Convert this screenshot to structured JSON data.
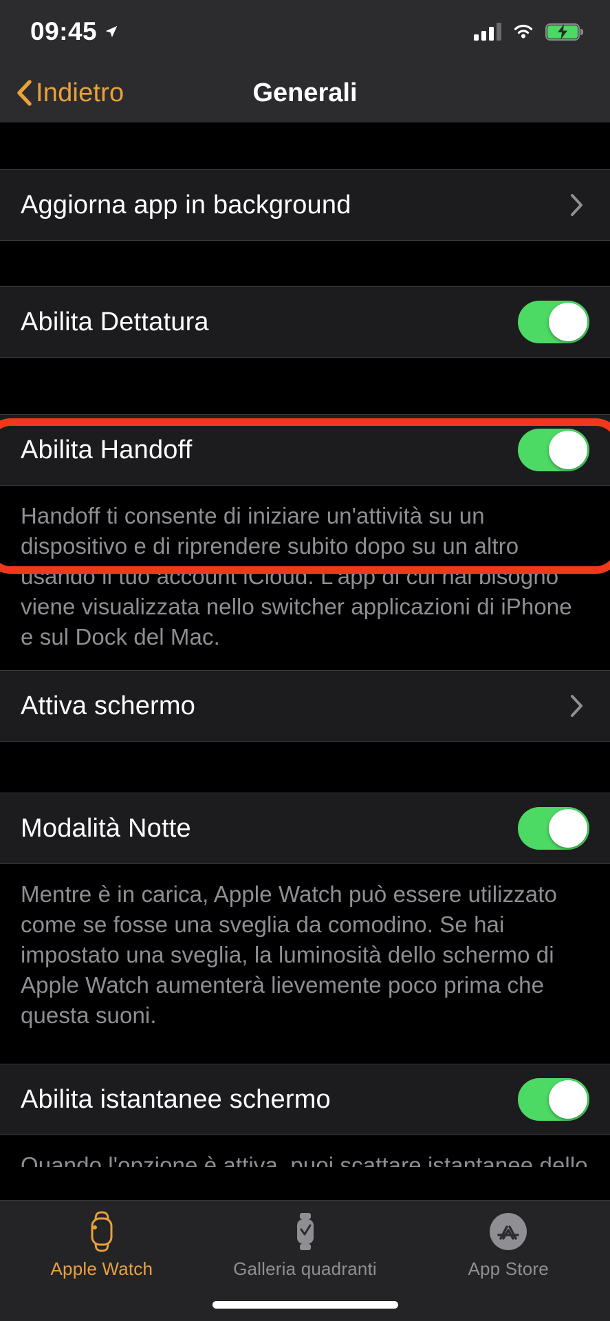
{
  "status_bar": {
    "time": "09:45",
    "location_icon": "location-arrow-icon",
    "signal_icon": "cellular-signal-icon",
    "wifi_icon": "wifi-icon",
    "battery_icon": "battery-charging-icon",
    "signal_bars_filled": 3,
    "signal_bars_total": 4
  },
  "nav": {
    "back_label": "Indietro",
    "title": "Generali",
    "back_icon": "chevron-left-icon",
    "accent_color": "#E8A13C"
  },
  "sections": [
    {
      "rows": [
        {
          "label": "Aggiorna app in background",
          "type": "disclosure",
          "accessory_icon": "chevron-right-icon"
        }
      ]
    },
    {
      "rows": [
        {
          "label": "Abilita Dettatura",
          "type": "toggle",
          "value": "on"
        }
      ]
    },
    {
      "highlighted": true,
      "rows": [
        {
          "label": "Abilita Handoff",
          "type": "toggle",
          "value": "on"
        }
      ],
      "footnote": "Handoff ti consente di iniziare un'attività su un dispositivo e di riprendere subito dopo su un altro usando il tuo account iCloud. L'app di cui hai bisogno viene visualizzata nello switcher applicazioni di iPhone e sul Dock del Mac."
    },
    {
      "rows": [
        {
          "label": "Attiva schermo",
          "type": "disclosure",
          "accessory_icon": "chevron-right-icon"
        }
      ]
    },
    {
      "rows": [
        {
          "label": "Modalità Notte",
          "type": "toggle",
          "value": "on"
        }
      ],
      "footnote": "Mentre è in carica, Apple Watch può essere utilizzato come se fosse una sveglia da comodino. Se hai impostato una sveglia, la luminosità dello schermo di Apple Watch aumenterà lievemente poco prima che questa suoni."
    },
    {
      "rows": [
        {
          "label": "Abilita istantanee schermo",
          "type": "toggle",
          "value": "on"
        }
      ],
      "footnote": "Quando l'opzione è attiva, puoi scattare istantanee dello"
    }
  ],
  "highlight": {
    "color": "#F0391A",
    "target": "Abilita Handoff"
  },
  "tab_bar": {
    "tabs": [
      {
        "label": "Apple Watch",
        "icon": "apple-watch-icon",
        "active": true
      },
      {
        "label": "Galleria quadranti",
        "icon": "watch-face-gallery-icon",
        "active": false
      },
      {
        "label": "App Store",
        "icon": "app-store-icon",
        "active": false
      }
    ],
    "active_color": "#E8A13C",
    "inactive_color": "#8E8E93"
  },
  "colors": {
    "toggle_on": "#4CD964",
    "row_background": "#1C1C1E",
    "page_background": "#000000",
    "chrome_background": "#2C2C2E"
  }
}
